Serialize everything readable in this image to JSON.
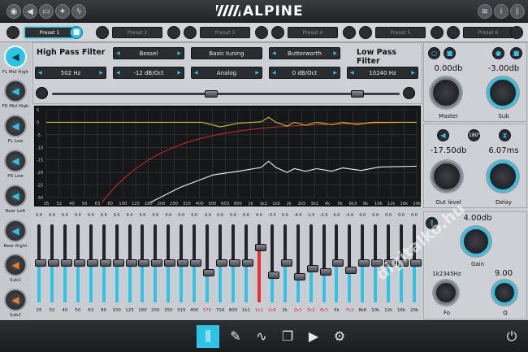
{
  "brand": "ALPINE",
  "presets": [
    {
      "label": "Preset 1",
      "active": true
    },
    {
      "label": "Preset 2",
      "active": false
    },
    {
      "label": "Preset 3",
      "active": false
    },
    {
      "label": "Preset 4",
      "active": false
    },
    {
      "label": "Preset 5",
      "active": false
    },
    {
      "label": "Preset 6",
      "active": false
    }
  ],
  "channels": [
    {
      "label": "FL Mid High",
      "icon": "speaker-icon",
      "selected": true,
      "color": "#2cc3e6"
    },
    {
      "label": "FR Mid High",
      "icon": "speaker-icon",
      "selected": false,
      "color": "#2cc3e6"
    },
    {
      "label": "FL Low",
      "icon": "speaker-icon",
      "selected": false,
      "color": "#2cc3e6"
    },
    {
      "label": "FR Low",
      "icon": "speaker-icon",
      "selected": false,
      "color": "#2cc3e6"
    },
    {
      "label": "Rear Left",
      "icon": "speaker-icon",
      "selected": false,
      "color": "#2cc3e6"
    },
    {
      "label": "Rear Right",
      "icon": "speaker-icon",
      "selected": false,
      "color": "#2cc3e6"
    },
    {
      "label": "Sub1",
      "icon": "speaker-icon",
      "selected": false,
      "color": "#f07b22"
    },
    {
      "label": "Sub2",
      "icon": "speaker-icon",
      "selected": false,
      "color": "#f07b22"
    }
  ],
  "filters": {
    "hpf_title": "High Pass Filter",
    "lpf_title": "Low Pass Filter",
    "hpf_type": "Bessel",
    "tuning_mode": "Basic tuning",
    "lpf_type": "Butterworth",
    "hpf_freq": "502 Hz",
    "hpf_slope": "-12 dB/Oct",
    "analog_mode": "Analog",
    "lpf_slope": "0 dB/Oct",
    "lpf_freq": "10240 Hz"
  },
  "graph": {
    "y_ticks": [
      "5",
      "0",
      "-5",
      "-10",
      "-15",
      "-20",
      "-25",
      "-30"
    ],
    "x_ticks": [
      "25",
      "32",
      "40",
      "50",
      "63",
      "80",
      "100",
      "125",
      "160",
      "200",
      "250",
      "315",
      "400",
      "500",
      "603",
      "800",
      "1k",
      "1k2",
      "1k6",
      "2k",
      "2k5",
      "3k2",
      "4k",
      "5k",
      "6k3",
      "8k",
      "10k",
      "12k",
      "16k",
      "20k"
    ]
  },
  "master": {
    "value": "0.00db",
    "label": "Master",
    "icon": "lock-icon"
  },
  "sub": {
    "value": "-3.00db",
    "label": "Sub",
    "icon": "lock-icon"
  },
  "out": {
    "value": "-17.50db",
    "label": "Out level",
    "phase": "180°"
  },
  "delay": {
    "value": "6.07ms",
    "label": "Delay"
  },
  "eq_param": {
    "gain_value": "4.00db",
    "gain_label": "Gain",
    "fo_value": "1k2345Hz",
    "fo_label": "Fo",
    "q_value": "9.00",
    "q_label": "Q"
  },
  "eq": {
    "bands": [
      {
        "freq": "25",
        "value": "0.0",
        "level": 0.5
      },
      {
        "freq": "32",
        "value": "0.0",
        "level": 0.5
      },
      {
        "freq": "40",
        "value": "0.0",
        "level": 0.5
      },
      {
        "freq": "50",
        "value": "0.0",
        "level": 0.5
      },
      {
        "freq": "63",
        "value": "0.0",
        "level": 0.5
      },
      {
        "freq": "80",
        "value": "0.0",
        "level": 0.5
      },
      {
        "freq": "100",
        "value": "0.0",
        "level": 0.5
      },
      {
        "freq": "125",
        "value": "0.0",
        "level": 0.5
      },
      {
        "freq": "160",
        "value": "0.0",
        "level": 0.5
      },
      {
        "freq": "200",
        "value": "0.0",
        "level": 0.5
      },
      {
        "freq": "250",
        "value": "0.0",
        "level": 0.5
      },
      {
        "freq": "315",
        "value": "0.0",
        "level": 0.5
      },
      {
        "freq": "400",
        "value": "0.0",
        "level": 0.5
      },
      {
        "freq": "570",
        "value": "-3.0",
        "level": 0.37
      },
      {
        "freq": "716",
        "value": "0.0",
        "level": 0.5
      },
      {
        "freq": "800",
        "value": "0.0",
        "level": 0.5
      },
      {
        "freq": "1k1",
        "value": "0.0",
        "level": 0.5
      },
      {
        "freq": "1k2",
        "value": "4.0",
        "level": 0.7,
        "active": true
      },
      {
        "freq": "1k8",
        "value": "-3.5",
        "level": 0.34
      },
      {
        "freq": "2k",
        "value": "0.0",
        "level": 0.5
      },
      {
        "freq": "2k5",
        "value": "-4.0",
        "level": 0.32
      },
      {
        "freq": "3k2",
        "value": "-1.5",
        "level": 0.43
      },
      {
        "freq": "4k3",
        "value": "-2.5",
        "level": 0.39
      },
      {
        "freq": "5k",
        "value": "0.0",
        "level": 0.5
      },
      {
        "freq": "7k2",
        "value": "-2.0",
        "level": 0.41
      },
      {
        "freq": "8k6",
        "value": "0.0",
        "level": 0.5
      },
      {
        "freq": "10k",
        "value": "0.0",
        "level": 0.5
      },
      {
        "freq": "12k",
        "value": "0.0",
        "level": 0.5
      },
      {
        "freq": "16k",
        "value": "0.0",
        "level": 0.5
      },
      {
        "freq": "20k",
        "value": "0.0",
        "level": 0.5
      }
    ]
  },
  "watermark": "digitalko.hu",
  "bottom": [
    {
      "name": "mixer-icon",
      "glyph": "⫼",
      "active": true
    },
    {
      "name": "pen-icon",
      "glyph": "✎",
      "active": false
    },
    {
      "name": "wave-icon",
      "glyph": "∿",
      "active": false
    },
    {
      "name": "copy-icon",
      "glyph": "❐",
      "active": false
    },
    {
      "name": "play-step-icon",
      "glyph": "▶",
      "active": false
    },
    {
      "name": "gear-icon",
      "glyph": "⚙",
      "active": false
    },
    {
      "name": "power-icon",
      "glyph": "⏻",
      "active": false
    }
  ],
  "colors": {
    "accent": "#2cc3e6",
    "warn": "#f07b22",
    "active_eq": "#e53030"
  }
}
